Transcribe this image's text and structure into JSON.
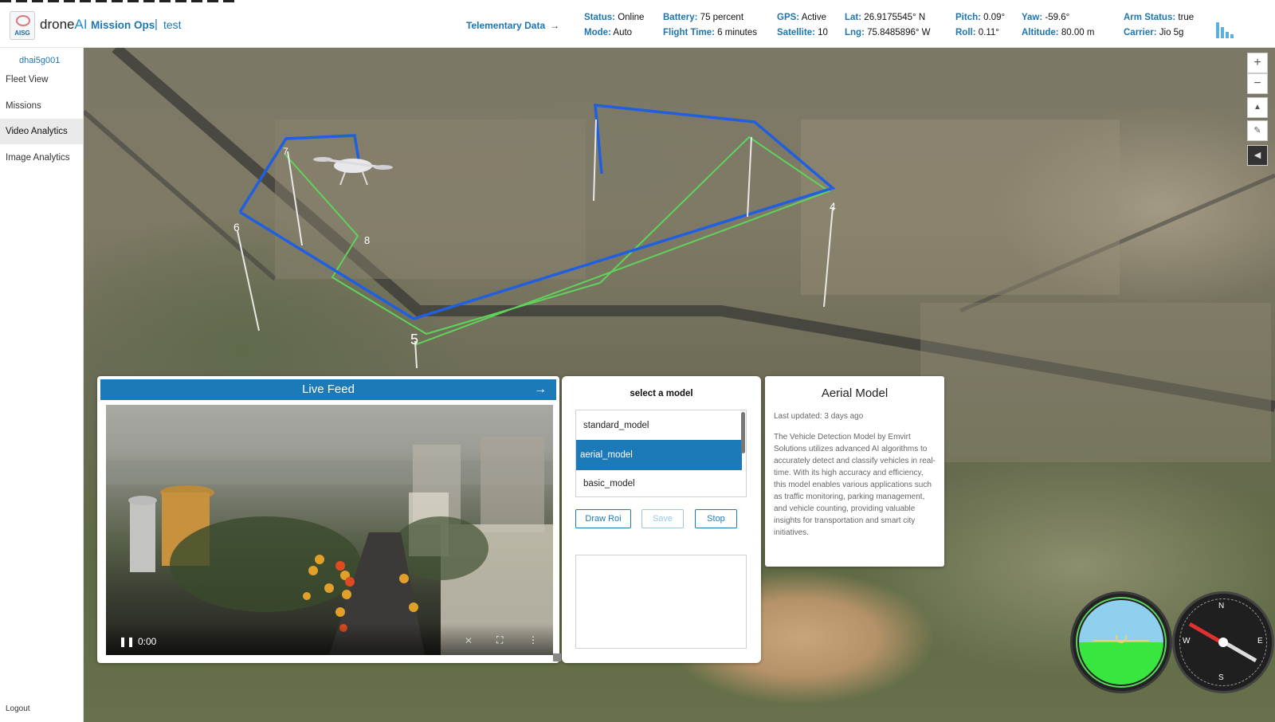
{
  "header": {
    "logo_text": "AISG",
    "brand_prefix": "drone",
    "brand_suffix": "AI",
    "brand_product": "Mission Ops",
    "separator": "|",
    "project": "test",
    "telemetry_link": "Telementary Data",
    "telemetry_arrow": "→"
  },
  "telemetry": {
    "status_label": "Status:",
    "status": "Online",
    "mode_label": "Mode:",
    "mode": "Auto",
    "battery_label": "Battery:",
    "battery": "75 percent",
    "flight_time_label": "Flight Time:",
    "flight_time": "6 minutes",
    "gps_label": "GPS:",
    "gps": "Active",
    "satellite_label": "Satellite:",
    "satellite": "10",
    "lat_label": "Lat:",
    "lat": "26.9175545° N",
    "lng_label": "Lng:",
    "lng": "75.8485896° W",
    "pitch_label": "Pitch:",
    "pitch": "0.09°",
    "roll_label": "Roll:",
    "roll": "0.11°",
    "yaw_label": "Yaw:",
    "yaw": "-59.6°",
    "altitude_label": "Altitude:",
    "altitude": "80.00 m",
    "arm_label": "Arm Status:",
    "arm": "true",
    "carrier_label": "Carrier:",
    "carrier": "Jio 5g"
  },
  "sidebar": {
    "device": "dhai5g001",
    "items": [
      {
        "label": "Fleet View"
      },
      {
        "label": "Missions"
      },
      {
        "label": "Video Analytics"
      },
      {
        "label": "Image Analytics"
      }
    ],
    "active_index": 2,
    "logout": "Logout"
  },
  "map": {
    "waypoint_labels": [
      "4",
      "5",
      "6",
      "7",
      "8"
    ],
    "controls": [
      "+",
      "−"
    ]
  },
  "live_feed": {
    "title": "Live Feed",
    "arrow": "→",
    "time": "0:00",
    "play_icon": "pause-icon"
  },
  "model_selector": {
    "title": "select a model",
    "models": [
      "standard_model",
      "aerial_model",
      "basic_model"
    ],
    "selected_index": 1,
    "buttons": {
      "draw_roi": "Draw Roi",
      "save": "Save",
      "stop": "Stop"
    }
  },
  "model_info": {
    "title": "Aerial Model",
    "updated": "Last updated: 3 days ago",
    "description": "The Vehicle Detection Model by Emvirt Solutions utilizes advanced AI algorithms to accurately detect and classify vehicles in real-time. With its high accuracy and efficiency, this model enables various applications such as traffic monitoring, parking management, and vehicle counting, providing valuable insights for transportation and smart city initiatives."
  },
  "instruments": {
    "compass_labels": [
      "N",
      "E",
      "S",
      "W"
    ]
  },
  "colors": {
    "accent": "#1c7ab8",
    "mission_path": "#1f5fe0",
    "ground_path": "#5fd35a"
  }
}
